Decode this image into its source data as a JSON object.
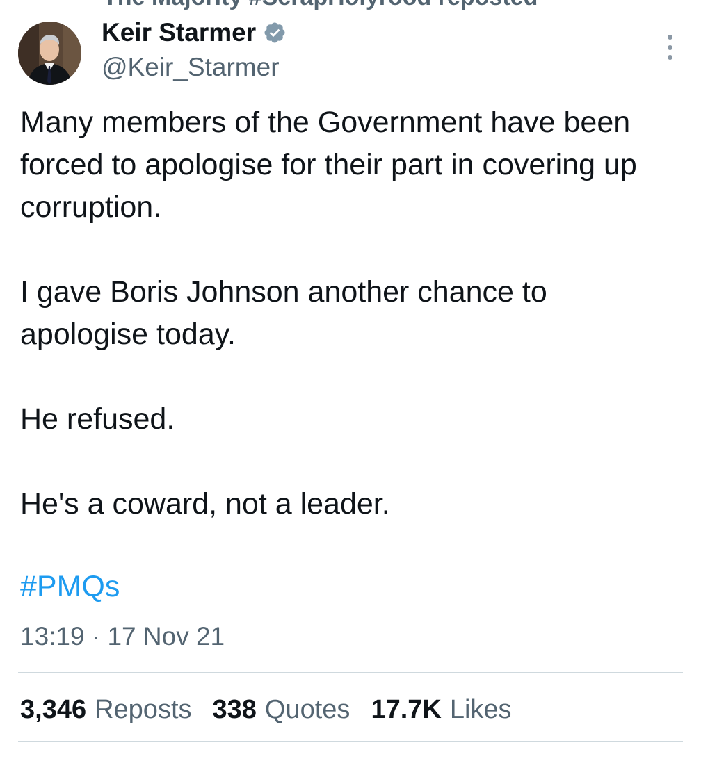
{
  "banner": {
    "text": "The Majority #ScrapHolyrood reposted"
  },
  "author": {
    "display_name": "Keir Starmer",
    "handle": "@Keir_Starmer",
    "verified_icon": "verified-badge-icon",
    "verified_color": "#829aab"
  },
  "tweet": {
    "paragraphs": [
      "Many members of the Government have been forced to apologise for their part in covering up corruption.",
      "I gave Boris Johnson another chance to apologise today.",
      "He refused.",
      "He's a coward, not a leader."
    ],
    "hashtag": "#PMQs",
    "timestamp": "13:19 · 17 Nov 21"
  },
  "stats": {
    "reposts_count": "3,346",
    "reposts_label": "Reposts",
    "quotes_count": "338",
    "quotes_label": "Quotes",
    "likes_count": "17.7K",
    "likes_label": "Likes"
  },
  "colors": {
    "text_primary": "#0f1419",
    "text_secondary": "#536471",
    "link": "#1d9bf0",
    "divider": "#cfd9de"
  },
  "icons": {
    "more": "more-options-icon"
  }
}
